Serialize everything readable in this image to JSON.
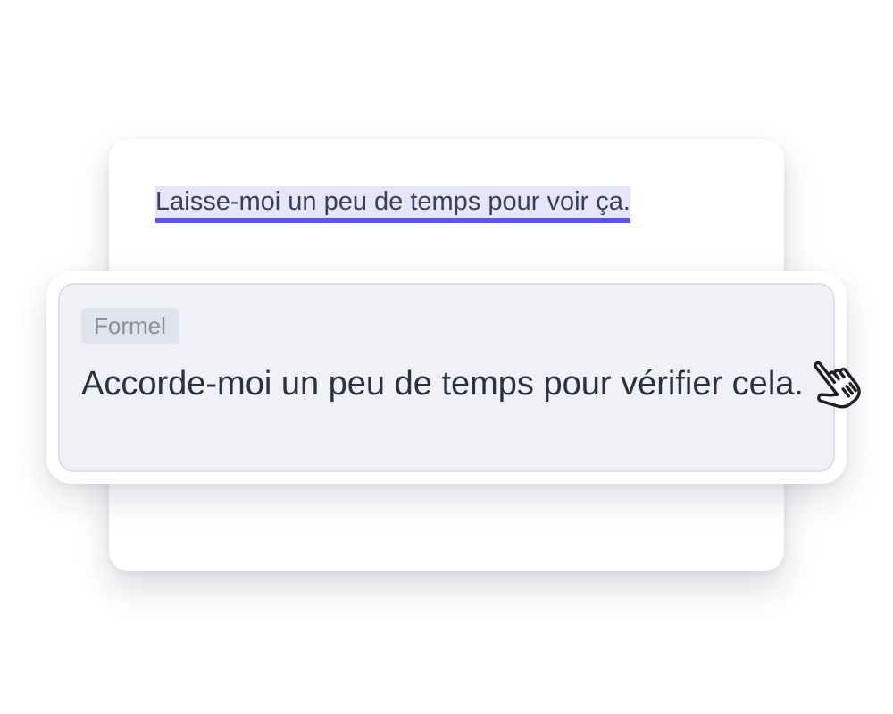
{
  "document": {
    "original_sentence": "Laisse-moi un peu de temps pour voir ça."
  },
  "suggestion": {
    "tone_label": "Formel",
    "text": "Accorde-moi un peu de temps pour vérifier cela."
  },
  "colors": {
    "highlight_background": "#e6e4ff",
    "underline_accent": "#5b54f5",
    "suggestion_background": "#f0f1f7",
    "badge_background": "#e1e3ec"
  },
  "icons": {
    "cursor": "pointer-hand-icon"
  }
}
